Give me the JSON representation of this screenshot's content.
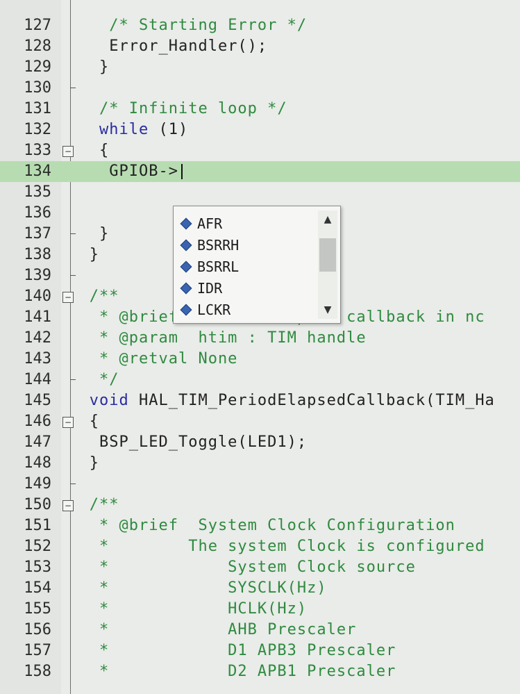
{
  "editor": {
    "lines": [
      {
        "n": "127",
        "indent": 5,
        "text": "/* Starting Error */",
        "style": "comment"
      },
      {
        "n": "128",
        "indent": 5,
        "text": "Error_Handler();",
        "style": "plain"
      },
      {
        "n": "129",
        "indent": 4,
        "text": "}",
        "style": "plain"
      },
      {
        "n": "130",
        "indent": 0,
        "text": "",
        "style": "plain"
      },
      {
        "n": "131",
        "indent": 4,
        "text": "/* Infinite loop */",
        "style": "comment"
      },
      {
        "n": "132",
        "indent": 4,
        "text": "while (1)",
        "style": "kw"
      },
      {
        "n": "133",
        "indent": 4,
        "text": "{",
        "style": "plain"
      },
      {
        "n": "134",
        "indent": 5,
        "text": "GPIOB->",
        "style": "plain"
      },
      {
        "n": "135",
        "indent": 0,
        "text": "",
        "style": "plain"
      },
      {
        "n": "136",
        "indent": 0,
        "text": "",
        "style": "plain"
      },
      {
        "n": "137",
        "indent": 4,
        "text": "}",
        "style": "plain"
      },
      {
        "n": "138",
        "indent": 3,
        "text": "}",
        "style": "plain"
      },
      {
        "n": "139",
        "indent": 0,
        "text": "",
        "style": "plain"
      },
      {
        "n": "140",
        "indent": 3,
        "text": "/**",
        "style": "comment"
      },
      {
        "n": "141",
        "indent": 4,
        "text": "* @brief  Period elapsed callback in nc",
        "style": "comment"
      },
      {
        "n": "142",
        "indent": 4,
        "text": "* @param  htim : TIM handle",
        "style": "comment"
      },
      {
        "n": "143",
        "indent": 4,
        "text": "* @retval None",
        "style": "comment"
      },
      {
        "n": "144",
        "indent": 4,
        "text": "*/",
        "style": "comment"
      },
      {
        "n": "145",
        "indent": 3,
        "text": "void HAL_TIM_PeriodElapsedCallback(TIM_Ha",
        "style": "mixed"
      },
      {
        "n": "146",
        "indent": 3,
        "text": "{",
        "style": "plain"
      },
      {
        "n": "147",
        "indent": 4,
        "text": "BSP_LED_Toggle(LED1);",
        "style": "plain"
      },
      {
        "n": "148",
        "indent": 3,
        "text": "}",
        "style": "plain"
      },
      {
        "n": "149",
        "indent": 0,
        "text": "",
        "style": "plain"
      },
      {
        "n": "150",
        "indent": 3,
        "text": "/**",
        "style": "comment"
      },
      {
        "n": "151",
        "indent": 4,
        "text": "* @brief  System Clock Configuration",
        "style": "comment"
      },
      {
        "n": "152",
        "indent": 4,
        "text": "*        The system Clock is configured",
        "style": "comment"
      },
      {
        "n": "153",
        "indent": 4,
        "text": "*            System Clock source",
        "style": "comment"
      },
      {
        "n": "154",
        "indent": 4,
        "text": "*            SYSCLK(Hz)",
        "style": "comment"
      },
      {
        "n": "155",
        "indent": 4,
        "text": "*            HCLK(Hz)",
        "style": "comment"
      },
      {
        "n": "156",
        "indent": 4,
        "text": "*            AHB Prescaler",
        "style": "comment"
      },
      {
        "n": "157",
        "indent": 4,
        "text": "*            D1 APB3 Prescaler",
        "style": "comment"
      },
      {
        "n": "158",
        "indent": 4,
        "text": "*            D2 APB1 Prescaler",
        "style": "comment"
      }
    ]
  },
  "autocomplete": {
    "items": [
      "AFR",
      "BSRRH",
      "BSRRL",
      "IDR",
      "LCKR"
    ]
  },
  "colors": {
    "comment": "#2f8a40",
    "keyword": "#2b2ba0",
    "current_line": "#b7dcb1"
  }
}
